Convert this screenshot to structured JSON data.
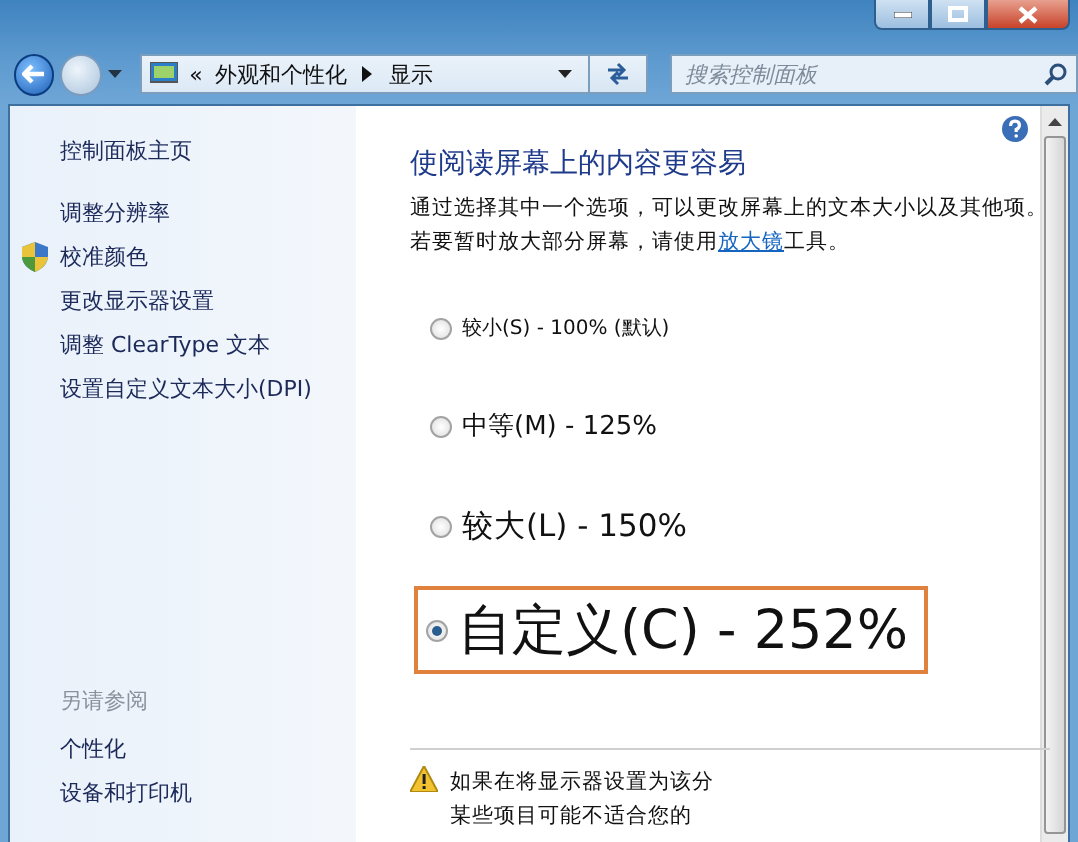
{
  "address_bar": {
    "overflow": "«",
    "path": [
      "外观和个性化",
      "显示"
    ]
  },
  "search": {
    "placeholder": "搜索控制面板"
  },
  "sidebar": {
    "home": "控制面板主页",
    "items": [
      {
        "label": "调整分辨率",
        "kind": "link"
      },
      {
        "label": "校准颜色",
        "kind": "shield"
      },
      {
        "label": "更改显示器设置",
        "kind": "link"
      },
      {
        "label": "调整 ClearType 文本",
        "kind": "link"
      },
      {
        "label": "设置自定义文本大小(DPI)",
        "kind": "link"
      }
    ],
    "see_also": {
      "title": "另请参阅",
      "items": [
        "个性化",
        "设备和打印机"
      ]
    }
  },
  "main": {
    "title": "使阅读屏幕上的内容更容易",
    "text_before": "通过选择其中一个选项，可以更改屏幕上的文本大小以及其他项。若要暂时放大部分屏幕，请使用",
    "link": "放大镜",
    "text_after": "工具。",
    "options": [
      {
        "label": "较小(S) - 100% (默认)",
        "kind": "small",
        "selected": false,
        "highlighted": false
      },
      {
        "label": "中等(M) - 125%",
        "kind": "medium",
        "selected": false,
        "highlighted": false
      },
      {
        "label": "较大(L) - 150%",
        "kind": "large",
        "selected": false,
        "highlighted": false
      },
      {
        "label": "自定义(C) - 252%",
        "kind": "custom",
        "selected": true,
        "highlighted": true
      }
    ],
    "warning": [
      "如果在将显示器设置为该分",
      "某些项目可能不适合您的"
    ]
  }
}
